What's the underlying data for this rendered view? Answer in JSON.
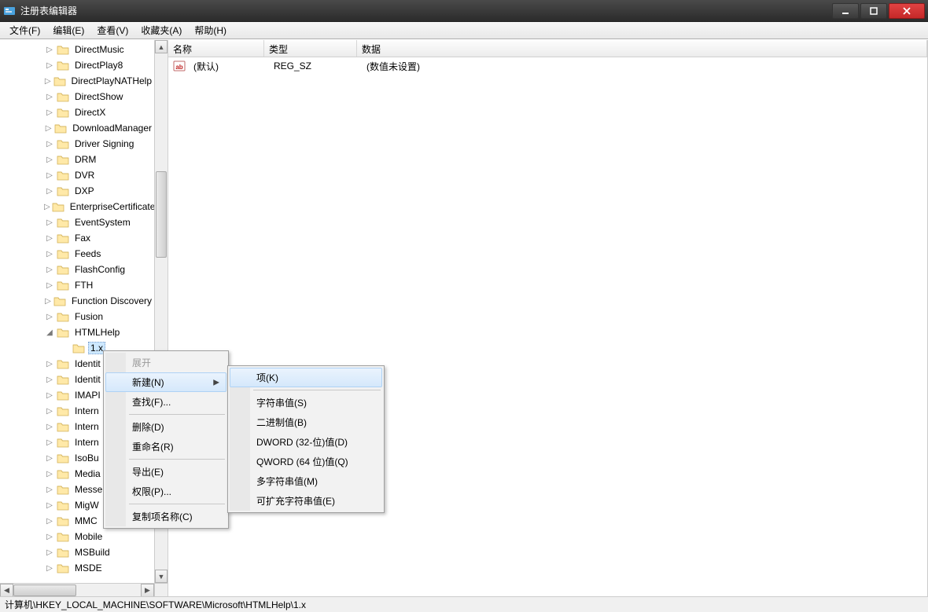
{
  "window": {
    "title": "注册表编辑器"
  },
  "menubar": [
    "文件(F)",
    "编辑(E)",
    "查看(V)",
    "收藏夹(A)",
    "帮助(H)"
  ],
  "tree": {
    "indent_base": 56,
    "items": [
      {
        "label": "DirectMusic",
        "expander": "▷",
        "indent": 56
      },
      {
        "label": "DirectPlay8",
        "expander": "▷",
        "indent": 56
      },
      {
        "label": "DirectPlayNATHelp",
        "expander": "▷",
        "indent": 56
      },
      {
        "label": "DirectShow",
        "expander": "▷",
        "indent": 56
      },
      {
        "label": "DirectX",
        "expander": "▷",
        "indent": 56
      },
      {
        "label": "DownloadManager",
        "expander": "▷",
        "indent": 56
      },
      {
        "label": "Driver Signing",
        "expander": "▷",
        "indent": 56
      },
      {
        "label": "DRM",
        "expander": "▷",
        "indent": 56
      },
      {
        "label": "DVR",
        "expander": "▷",
        "indent": 56
      },
      {
        "label": "DXP",
        "expander": "▷",
        "indent": 56
      },
      {
        "label": "EnterpriseCertificate",
        "expander": "▷",
        "indent": 56
      },
      {
        "label": "EventSystem",
        "expander": "▷",
        "indent": 56
      },
      {
        "label": "Fax",
        "expander": "▷",
        "indent": 56
      },
      {
        "label": "Feeds",
        "expander": "▷",
        "indent": 56
      },
      {
        "label": "FlashConfig",
        "expander": "▷",
        "indent": 56
      },
      {
        "label": "FTH",
        "expander": "▷",
        "indent": 56
      },
      {
        "label": "Function Discovery",
        "expander": "▷",
        "indent": 56
      },
      {
        "label": "Fusion",
        "expander": "▷",
        "indent": 56
      },
      {
        "label": "HTMLHelp",
        "expander": "◢",
        "indent": 56
      },
      {
        "label": "1.x",
        "expander": "",
        "indent": 76,
        "selected": true
      },
      {
        "label": "Identit",
        "expander": "▷",
        "indent": 56
      },
      {
        "label": "Identit",
        "expander": "▷",
        "indent": 56
      },
      {
        "label": "IMAPI",
        "expander": "▷",
        "indent": 56
      },
      {
        "label": "Intern",
        "expander": "▷",
        "indent": 56
      },
      {
        "label": "Intern",
        "expander": "▷",
        "indent": 56
      },
      {
        "label": "Intern",
        "expander": "▷",
        "indent": 56
      },
      {
        "label": "IsoBu",
        "expander": "▷",
        "indent": 56
      },
      {
        "label": "Media",
        "expander": "▷",
        "indent": 56
      },
      {
        "label": "Messe",
        "expander": "▷",
        "indent": 56
      },
      {
        "label": "MigW",
        "expander": "▷",
        "indent": 56
      },
      {
        "label": "MMC",
        "expander": "▷",
        "indent": 56
      },
      {
        "label": "Mobile",
        "expander": "▷",
        "indent": 56
      },
      {
        "label": "MSBuild",
        "expander": "▷",
        "indent": 56
      },
      {
        "label": "MSDE",
        "expander": "▷",
        "indent": 56
      }
    ]
  },
  "columns": {
    "name": "名称",
    "type": "类型",
    "data": "数据"
  },
  "rows": [
    {
      "name": "(默认)",
      "type": "REG_SZ",
      "data": "(数值未设置)"
    }
  ],
  "context_menu": {
    "items": [
      {
        "label": "展开",
        "disabled": true
      },
      {
        "label": "新建(N)",
        "hover": true,
        "submenu": true
      },
      {
        "label": "查找(F)...",
        "disabled": false
      },
      {
        "sep": true
      },
      {
        "label": "删除(D)"
      },
      {
        "label": "重命名(R)"
      },
      {
        "sep": true
      },
      {
        "label": "导出(E)"
      },
      {
        "label": "权限(P)..."
      },
      {
        "sep": true
      },
      {
        "label": "复制项名称(C)"
      }
    ]
  },
  "submenu": {
    "items": [
      {
        "label": "项(K)",
        "hover": true
      },
      {
        "sep": true
      },
      {
        "label": "字符串值(S)"
      },
      {
        "label": "二进制值(B)"
      },
      {
        "label": "DWORD (32-位)值(D)"
      },
      {
        "label": "QWORD (64 位)值(Q)"
      },
      {
        "label": "多字符串值(M)"
      },
      {
        "label": "可扩充字符串值(E)"
      }
    ]
  },
  "statusbar": "计算机\\HKEY_LOCAL_MACHINE\\SOFTWARE\\Microsoft\\HTMLHelp\\1.x"
}
